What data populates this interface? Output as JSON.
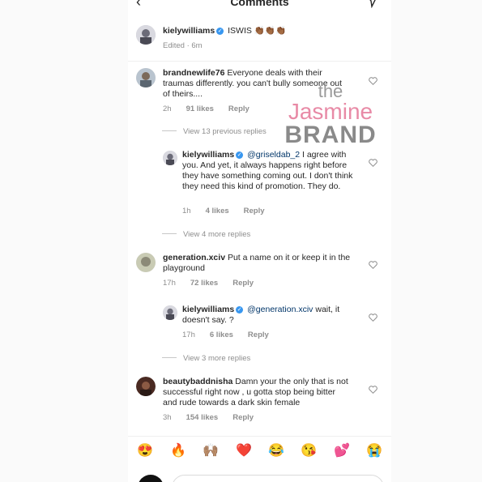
{
  "header": {
    "title": "Comments"
  },
  "caption": {
    "user": "kielywilliams",
    "text": "ISWIS 👏🏾👏🏾👏🏾",
    "meta": "Edited · 6m"
  },
  "comments": [
    {
      "user": "brandnewlife76",
      "text": "Everyone deals with their traumas differently. you can't bully someone out of theirs....",
      "time": "2h",
      "likes": "91 likes",
      "reply": "Reply",
      "view_more": "View 13 previous replies"
    },
    {
      "user": "kielywilliams",
      "mention": "@griseldab_2",
      "text": " I agree with you. And yet, it always happens right before they have something coming out. I don't think they need this kind of promotion. They do.",
      "time": "1h",
      "likes": "4 likes",
      "reply": "Reply",
      "view_more": "View 4 more replies"
    },
    {
      "user": "generation.xciv",
      "text": "Put a name on it or keep it in the playground",
      "time": "17h",
      "likes": "72 likes",
      "reply": "Reply"
    },
    {
      "user": "kielywilliams",
      "mention": "@generation.xciv",
      "text": " wait, it doesn't say. ?",
      "time": "17h",
      "likes": "6 likes",
      "reply": "Reply",
      "view_more": "View 3 more replies"
    },
    {
      "user": "beautybaddnisha",
      "text": "Damn your the only that is not successful right now , u  gotta stop being bitter and rude towards a dark skin female",
      "time": "3h",
      "likes": "154 likes",
      "reply": "Reply"
    }
  ],
  "emoji_bar": [
    "😍",
    "🔥",
    "🙌🏽",
    "❤️",
    "😂",
    "😘",
    "💕",
    "😭"
  ],
  "watermark": {
    "line1": "the",
    "line2": "Jasmine",
    "line3": "BRAND"
  },
  "colors": {
    "link": "#003569",
    "muted": "#8e8e8e",
    "verified": "#3897f0",
    "watermark_pink": "#e88aa6"
  }
}
